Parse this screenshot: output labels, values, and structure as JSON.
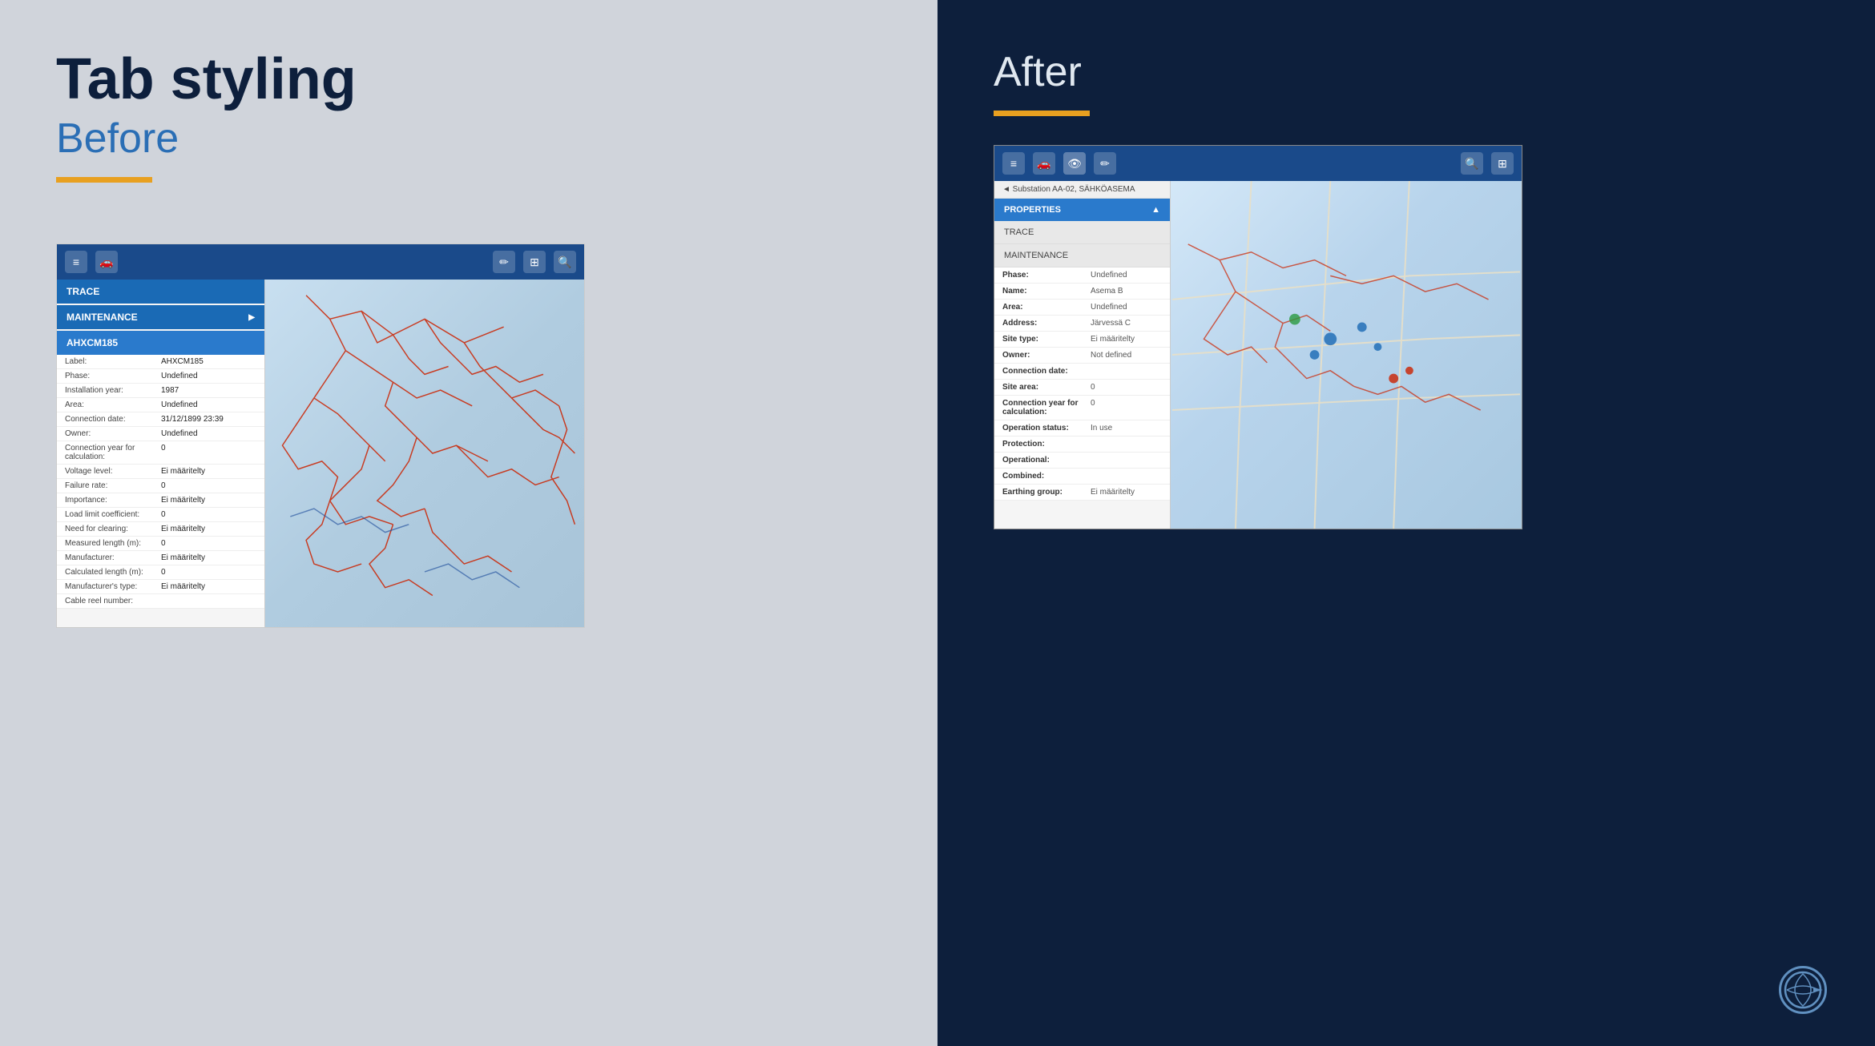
{
  "left": {
    "main_title": "Tab styling",
    "subtitle": "Before",
    "before_header": {
      "tabs": [
        "≡",
        "🚗",
        "✏"
      ]
    },
    "before_sidebar": {
      "tab_trace": "TRACE",
      "tab_maintenance": "MAINTENANCE",
      "tab_ahxcm": "AHXCM185",
      "properties": [
        {
          "label": "Label:",
          "value": "AHXCM185"
        },
        {
          "label": "Phase:",
          "value": "Undefined"
        },
        {
          "label": "Installation year:",
          "value": "1987"
        },
        {
          "label": "Area:",
          "value": "Undefined"
        },
        {
          "label": "Connection date:",
          "value": "31/12/1899 23:39"
        },
        {
          "label": "Owner:",
          "value": "Undefined"
        },
        {
          "label": "Connection year for calculation:",
          "value": "0"
        },
        {
          "label": "Voltage level:",
          "value": "Ei määritelty"
        },
        {
          "label": "Failure rate:",
          "value": "0"
        },
        {
          "label": "Importance:",
          "value": "Ei määritelty"
        },
        {
          "label": "Load limit coefficient:",
          "value": "0"
        },
        {
          "label": "Need for clearing:",
          "value": "Ei määritelty"
        },
        {
          "label": "Measured length (m):",
          "value": "0"
        },
        {
          "label": "Manufacturer:",
          "value": "Ei määritelty"
        },
        {
          "label": "Calculated length (m):",
          "value": "0"
        },
        {
          "label": "Manufacturer's type:",
          "value": "Ei määritelty"
        },
        {
          "label": "Cable reel number:",
          "value": ""
        }
      ]
    }
  },
  "right": {
    "after_title": "After",
    "after_header": {
      "tabs": [
        "≡",
        "🚗",
        "👁",
        "✏"
      ]
    },
    "after_sidebar": {
      "breadcrumb": "◄  Substation AA-02, SÄHKÖASEMA",
      "tab_properties": "PROPERTIES",
      "tab_trace": "TRACE",
      "tab_maintenance": "MAINTENANCE",
      "properties": [
        {
          "label": "Phase:",
          "value": "Undefined"
        },
        {
          "label": "Name:",
          "value": "Asema B"
        },
        {
          "label": "Area:",
          "value": "Undefined"
        },
        {
          "label": "Address:",
          "value": "Järvessä C"
        },
        {
          "label": "Site type:",
          "value": "Ei määritelty"
        },
        {
          "label": "Owner:",
          "value": "Not defined"
        },
        {
          "label": "Connection date:",
          "value": ""
        },
        {
          "label": "Site area:",
          "value": "0"
        },
        {
          "label": "Connection year for calculation:",
          "value": "0"
        },
        {
          "label": "Operation status:",
          "value": "In use"
        },
        {
          "label": "Protection:",
          "value": ""
        },
        {
          "label": "Operational:",
          "value": ""
        },
        {
          "label": "Combined:",
          "value": ""
        },
        {
          "label": "Earthing group:",
          "value": "Ei määritelty"
        }
      ]
    },
    "logo": "❋"
  }
}
